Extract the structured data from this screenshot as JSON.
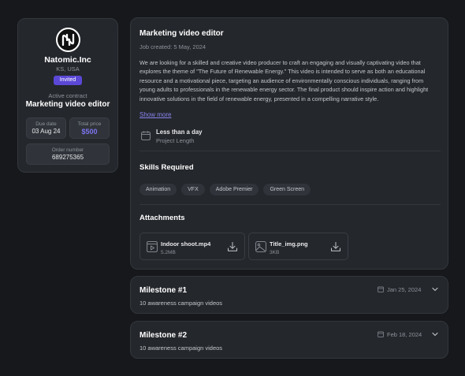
{
  "profile": {
    "company": "Natomic.Inc",
    "location": "KS, USA",
    "status_badge": "Invited",
    "active_label": "Active contract",
    "contract_title": "Marketing video editor",
    "due_label": "Due date",
    "due_value": "03 Aug 24",
    "price_label": "Total price",
    "price_value": "$500",
    "order_label": "Order number",
    "order_value": "689275365"
  },
  "job": {
    "title": "Marketing video editor",
    "created": "Job created: 5 May, 2024",
    "description": "We are looking for a skilled and creative video producer to craft an engaging and visually captivating video that explores the theme of \"The Future of Renewable Energy.\" This video is intended to serve as both an educational resource and a motivational piece, targeting an audience of environmentally conscious individuals, ranging from young adults to professionals in the renewable energy sector. The final product should inspire action and highlight innovative solutions in the field of renewable energy, presented in a compelling narrative style.",
    "show_more": "Show more",
    "length_title": "Less than a day",
    "length_sub": "Project Length"
  },
  "skills": {
    "title": "Skills Required",
    "items": [
      "Animation",
      "VFX",
      "Adobe Premier",
      "Green Screen"
    ]
  },
  "attachments": {
    "title": "Attachments",
    "items": [
      {
        "name": "Indoor shoot.mp4",
        "size": "5.2MB",
        "icon": "video-file-icon"
      },
      {
        "name": "Title_img.png",
        "size": "3KB",
        "icon": "image-file-icon"
      }
    ]
  },
  "milestones": [
    {
      "title": "Milestone #1",
      "date": "Jan 25, 2024",
      "description": "10 awareness campaign videos"
    },
    {
      "title": "Milestone #2",
      "date": "Feb 18, 2024",
      "description": "10 awareness campaign videos"
    }
  ],
  "colors": {
    "background": "#16181b",
    "card": "#24272c",
    "accent": "#5b48d6",
    "link": "#8a84ef"
  }
}
